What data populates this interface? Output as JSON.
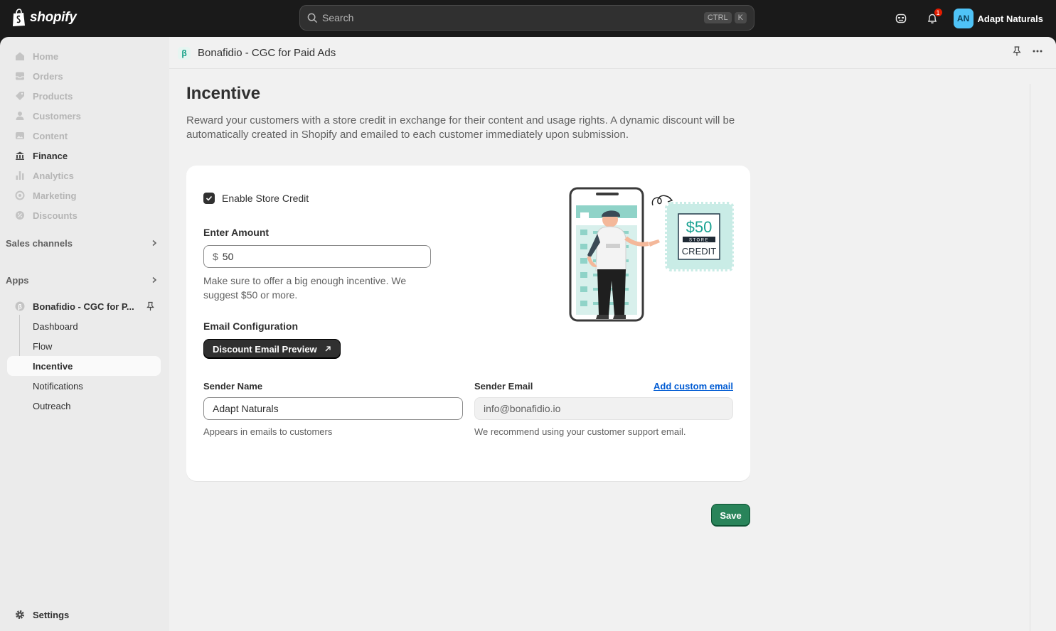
{
  "topbar": {
    "brand": "shopify",
    "search_placeholder": "Search",
    "shortcut_keys": [
      "CTRL",
      "K"
    ],
    "notification_count": "1",
    "account_initials": "AN",
    "account_name": "Adapt Naturals",
    "avatar_color": "#4fc3f7"
  },
  "sidebar": {
    "items": [
      {
        "label": "Home",
        "icon": "home-icon"
      },
      {
        "label": "Orders",
        "icon": "inbox-icon"
      },
      {
        "label": "Products",
        "icon": "tag-icon"
      },
      {
        "label": "Customers",
        "icon": "person-icon"
      },
      {
        "label": "Content",
        "icon": "image-icon"
      },
      {
        "label": "Finance",
        "icon": "bank-icon"
      },
      {
        "label": "Analytics",
        "icon": "bar-chart-icon"
      },
      {
        "label": "Marketing",
        "icon": "target-icon"
      },
      {
        "label": "Discounts",
        "icon": "discount-icon"
      }
    ],
    "sales_channels_label": "Sales channels",
    "apps_label": "Apps",
    "app_name": "Bonafidio - CGC for P...",
    "app_subitems": [
      "Dashboard",
      "Flow",
      "Incentive",
      "Notifications",
      "Outreach"
    ],
    "current_subitem": "Incentive",
    "settings_label": "Settings"
  },
  "app_header": {
    "icon_letter": "β",
    "title": "Bonafidio - CGC for Paid Ads"
  },
  "page": {
    "title": "Incentive",
    "description": "Reward your customers with a store credit in exchange for their content and usage rights. A dynamic discount will be automatically created in Shopify and emailed to each customer immediately upon submission."
  },
  "card": {
    "enable_label": "Enable Store Credit",
    "enable_checked": true,
    "amount_label": "Enter Amount",
    "currency_symbol": "$",
    "amount_value": "50",
    "amount_help": "Make sure to offer a big enough incentive. We suggest $50 or more.",
    "email_config_label": "Email Configuration",
    "preview_button": "Discount Email Preview",
    "sender_name_label": "Sender Name",
    "sender_name_value": "Adapt Naturals",
    "sender_name_help": "Appears in emails to customers",
    "sender_email_label": "Sender Email",
    "add_custom_email": "Add custom email",
    "sender_email_value": "info@bonafidio.io",
    "sender_email_help": "We recommend using your customer support email.",
    "illustration": {
      "amount": "$50",
      "word1": "STORE",
      "word2": "CREDIT"
    }
  },
  "save_label": "Save",
  "colors": {
    "save": "#29845a",
    "link": "#005bd3",
    "accent_teal": "#8fd3c8"
  }
}
